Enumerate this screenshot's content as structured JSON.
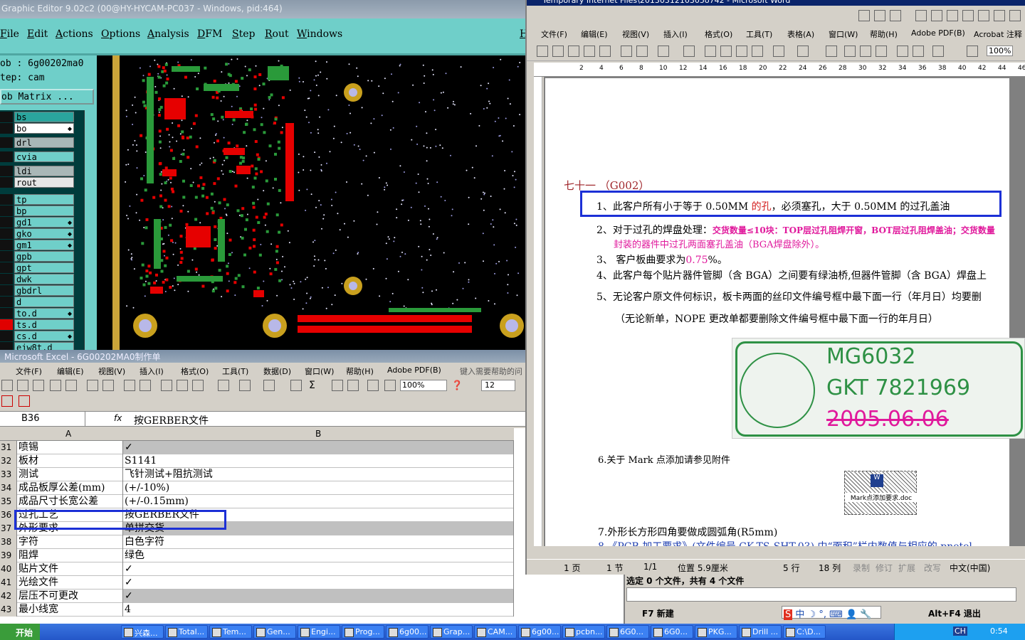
{
  "graphic_editor": {
    "title": "Graphic Editor 9.02c2 (00@HY-HYCAM-PC037 - Windows, pid:464)",
    "menu": [
      "File",
      "Edit",
      "Actions",
      "Options",
      "Analysis",
      "DFM",
      "Step",
      "Rout",
      "Windows",
      "H"
    ],
    "job_label": "ob : 6g00202ma0",
    "step_label": "tep: cam",
    "job_matrix": "ob Matrix ...",
    "layers": [
      {
        "name": "bs",
        "color": "#2aa59d",
        "arrow": ""
      },
      {
        "name": "bo",
        "color": "#ffffff",
        "arrow": "◆"
      },
      {
        "name": "drl",
        "color": "#a9b7b7",
        "arrow": ""
      },
      {
        "name": "cvia",
        "color": "#6fcfc9",
        "arrow": ""
      },
      {
        "name": "ldi",
        "color": "#a9b7b7",
        "arrow": ""
      },
      {
        "name": "rout",
        "color": "#e6e6e6",
        "arrow": ""
      },
      {
        "name": "tp",
        "color": "#6fcfc9",
        "arrow": ""
      },
      {
        "name": "bp",
        "color": "#6fcfc9",
        "arrow": ""
      },
      {
        "name": "gd1",
        "color": "#6fcfc9",
        "arrow": "◆"
      },
      {
        "name": "gko",
        "color": "#6fcfc9",
        "arrow": "◆"
      },
      {
        "name": "gm1",
        "color": "#6fcfc9",
        "arrow": "◆"
      },
      {
        "name": "gpb",
        "color": "#6fcfc9",
        "arrow": ""
      },
      {
        "name": "gpt",
        "color": "#6fcfc9",
        "arrow": ""
      },
      {
        "name": "dwk",
        "color": "#6fcfc9",
        "arrow": ""
      },
      {
        "name": "gbdrl",
        "color": "#6fcfc9",
        "arrow": ""
      },
      {
        "name": "d",
        "color": "#6fcfc9",
        "arrow": ""
      },
      {
        "name": "to.d",
        "color": "#6fcfc9",
        "arrow": "◆"
      },
      {
        "name": "ts.d",
        "color": "#6fcfc9",
        "arrow": ""
      },
      {
        "name": "cs.d",
        "color": "#6fcfc9",
        "arrow": "◆"
      },
      {
        "name": "ejw8t.d",
        "color": "#6fcfc9",
        "arrow": ""
      }
    ]
  },
  "word": {
    "title": "Temporary Internet Files\\2013031210305o742 - Microsoft Word",
    "menu": [
      "文件(F)",
      "编辑(E)",
      "视图(V)",
      "插入(I)",
      "格式(O)",
      "工具(T)",
      "表格(A)",
      "窗口(W)",
      "帮助(H)",
      "Adobe PDF(B)",
      "Acrobat 注释"
    ],
    "zoom": "100%",
    "ruler_ticks": [
      "2",
      "4",
      "6",
      "8",
      "10",
      "12",
      "14",
      "16",
      "18",
      "20",
      "22",
      "24",
      "26",
      "28",
      "30",
      "32",
      "34",
      "36",
      "38",
      "40",
      "42",
      "44",
      "46"
    ],
    "heading": "七十一  （G002）",
    "item1_pre": "1、此客户所有小于等于 0.50MM ",
    "item1_red": "的孔",
    "item1_post": "，必须塞孔，大于 0.50MM 的过孔盖油",
    "item2_pre": "2、对于过孔的焊盘处理：",
    "item2_red": "交货数量≤10块：TOP层过孔阻焊开窗，BOT层过孔阻焊盖油；交货数量",
    "item2_line2": "封装的器件中过孔两面塞孔盖油（BGA焊盘除外）。",
    "item3_pre": "3、  客户板曲要求为",
    "item3_val": "0.75",
    "item3_post": "%。",
    "item4": "4、此客户每个贴片器件管脚（含 BGA）之间要有绿油桥,但器件管脚（含 BGA）焊盘上",
    "item5": "5、无论客户原文件何标识，板卡两面的丝印文件编号框中最下面一行（年月日）均要删",
    "item5_note": "（无论新单，NOPE 更改单都要删除文件编号框中最下面一行的年月日）",
    "image_text1": "MG6032",
    "image_text2": "GKT 7821969",
    "image_text3": "2005.06.06",
    "item6": "6.关于 Mark 点添加请参见附件",
    "attachment": "Mark点添加要求.doc",
    "item7": "7.外形长方形四角要做成圆弧角(R5mm)",
    "item8": "8.《PCB 加工要求》(文件编号  CK-TS-SHT-03) 中“面积”栏内数值与相应的 pnetel",
    "status": {
      "page": "1 页",
      "section": "1 节",
      "pages": "1/1",
      "pos": "位置 5.9厘米",
      "line": "5 行",
      "col": "18 列",
      "rec": "录制",
      "rev": "修订",
      "ext": "扩展",
      "ovr": "改写",
      "lang": "中文(中国)"
    }
  },
  "excel": {
    "title": "Microsoft Excel - 6G00202MA0制作单",
    "menu": [
      "文件(F)",
      "编辑(E)",
      "视图(V)",
      "插入(I)",
      "格式(O)",
      "工具(T)",
      "数据(D)",
      "窗口(W)",
      "帮助(H)",
      "Adobe PDF(B)"
    ],
    "help_box": "键入需要帮助的问",
    "zoom": "100%",
    "font_size": "12",
    "name_box": "B36",
    "fx": "fx",
    "formula": "按GERBER文件",
    "col_a": "A",
    "col_b": "B",
    "rows": [
      {
        "n": "31",
        "a": "喷锡",
        "b": "✓",
        "gray": true
      },
      {
        "n": "32",
        "a": "板材",
        "b": "S1141",
        "gray": false
      },
      {
        "n": "33",
        "a": "测试",
        "b": "飞针测试+阻抗测试",
        "gray": false
      },
      {
        "n": "34",
        "a": "成品板厚公差(mm)",
        "b": "(+/-10%)",
        "gray": false
      },
      {
        "n": "35",
        "a": "成品尺寸长宽公差",
        "b": "(+/-0.15mm)",
        "gray": false
      },
      {
        "n": "36",
        "a": "过孔工艺",
        "b": "按GERBER文件",
        "gray": false
      },
      {
        "n": "37",
        "a": "外形要求",
        "b": "单拼交货",
        "gray": true
      },
      {
        "n": "38",
        "a": "字符",
        "b": "白色字符",
        "gray": false
      },
      {
        "n": "39",
        "a": "阻焊",
        "b": "绿色",
        "gray": false
      },
      {
        "n": "40",
        "a": "贴片文件",
        "b": "✓",
        "gray": false
      },
      {
        "n": "41",
        "a": "光绘文件",
        "b": "✓",
        "gray": false
      },
      {
        "n": "42",
        "a": "层压不可更改",
        "b": "✓",
        "gray": true
      },
      {
        "n": "43",
        "a": "最小线宽",
        "b": "4",
        "gray": false
      }
    ]
  },
  "file_manager": {
    "selection": "选定 0 个文件，共有 4 个文件",
    "f7": "F7 新建",
    "altf4": "Alt+F4 退出"
  },
  "taskbar": {
    "start": "开始",
    "tasks": [
      "兴森...",
      "Total...",
      "Tem...",
      "Gen...",
      "Engi...",
      "Prog...",
      "6g00...",
      "Grap...",
      "CAM...",
      "6g00...",
      "pcbn...",
      "6G0...",
      "6G0...",
      "PKG...",
      "Drill ...",
      "C:\\D..."
    ],
    "lang": "CH",
    "clock": "0:54"
  }
}
